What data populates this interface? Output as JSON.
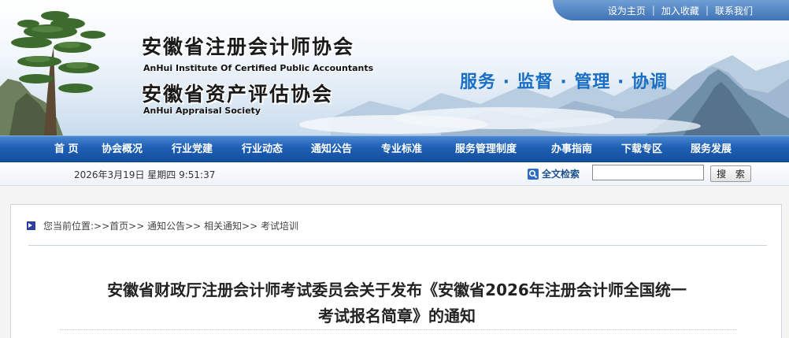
{
  "top_links": [
    "设为主页",
    "加入收藏",
    "联系我们"
  ],
  "org": {
    "name_cn_1": "安徽省注册会计师协会",
    "name_en_1": "AnHui Institute Of Certified Public Accountants",
    "name_cn_2": "安徽省资产评估协会",
    "name_en_2": "AnHui Appraisal Society",
    "slogan": "服务 · 监督 · 管理 · 协调"
  },
  "nav": {
    "items": [
      "首 页",
      "协会概况",
      "行业党建",
      "行业动态",
      "通知公告",
      "专业标准",
      "服务管理制度",
      "办事指南",
      "下载专区",
      "服务发展"
    ]
  },
  "strip": {
    "datetime": "2026年3月19日 星期四 9:51:37",
    "fulltext_label": "全文检索",
    "search_value": "",
    "search_button": "搜 索"
  },
  "breadcrumb": {
    "prefix": "您当前位置:",
    "items": [
      ">>首页",
      " >> 通知公告",
      " >> 相关通知",
      " >> 考试培训"
    ]
  },
  "article": {
    "title_line_1": "安徽省财政厅注册会计师考试委员会关于发布《安徽省2026年注册会计师全国统一",
    "title_line_2": "考试报名简章》的通知"
  },
  "colors": {
    "nav_blue": "#1d5fb5",
    "slogan_blue": "#1a6fc4",
    "toplinks_blue": "#3f73b6"
  }
}
